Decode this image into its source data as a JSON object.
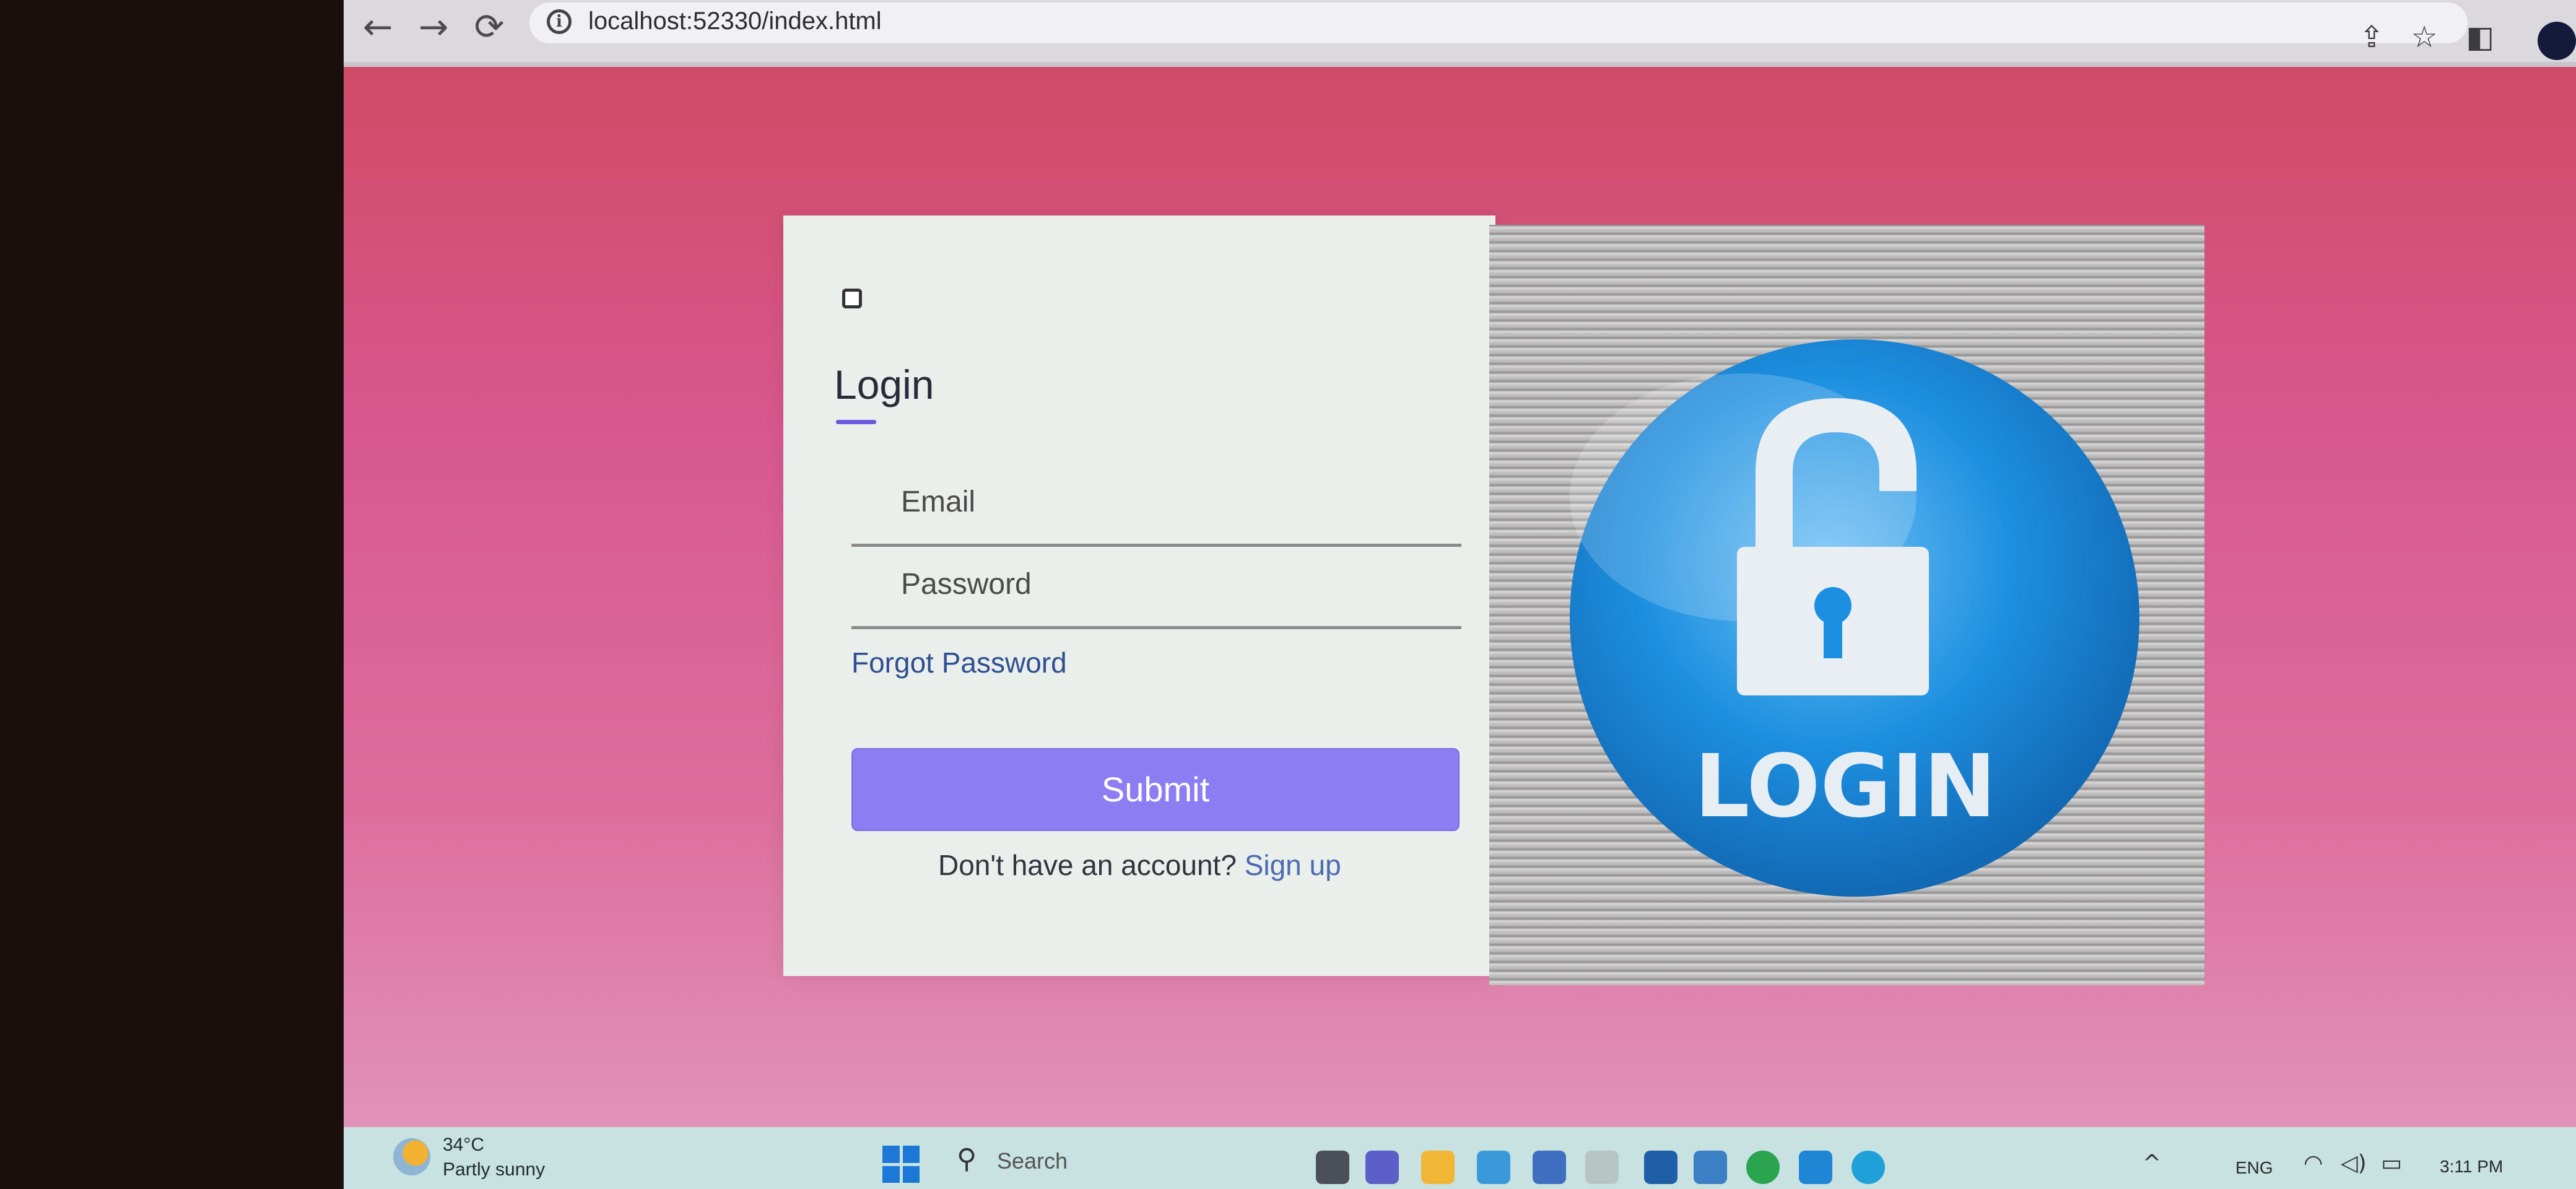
{
  "browser": {
    "url": "localhost:52330/index.html",
    "back_icon": "←",
    "forward_icon": "→",
    "reload_icon": "⟳",
    "info_icon": "i",
    "share_icon": "⇪",
    "star_icon": "☆",
    "sidepanel_icon": "◧"
  },
  "login": {
    "title": "Login",
    "email_placeholder": "Email",
    "password_placeholder": "Password",
    "forgot_label": "Forgot Password",
    "submit_label": "Submit",
    "signup_prompt": "Don't have an account?",
    "signup_link": "Sign up"
  },
  "hero": {
    "label": "LOGIN"
  },
  "taskbar": {
    "temperature": "34°C",
    "weather": "Partly sunny",
    "search_placeholder": "Search",
    "search_icon": "⚲",
    "language": "ENG",
    "clock": "3:11 PM",
    "chevron_icon": "^",
    "wifi_icon": "◠",
    "volume_icon": "◁)",
    "battery_icon": "▭"
  },
  "colors": {
    "accent": "#8c7ef2",
    "link": "#2f4f91",
    "page_top": "#cf4b66",
    "page_bottom": "#e192b9",
    "lock_blue": "#1d8fe0"
  }
}
